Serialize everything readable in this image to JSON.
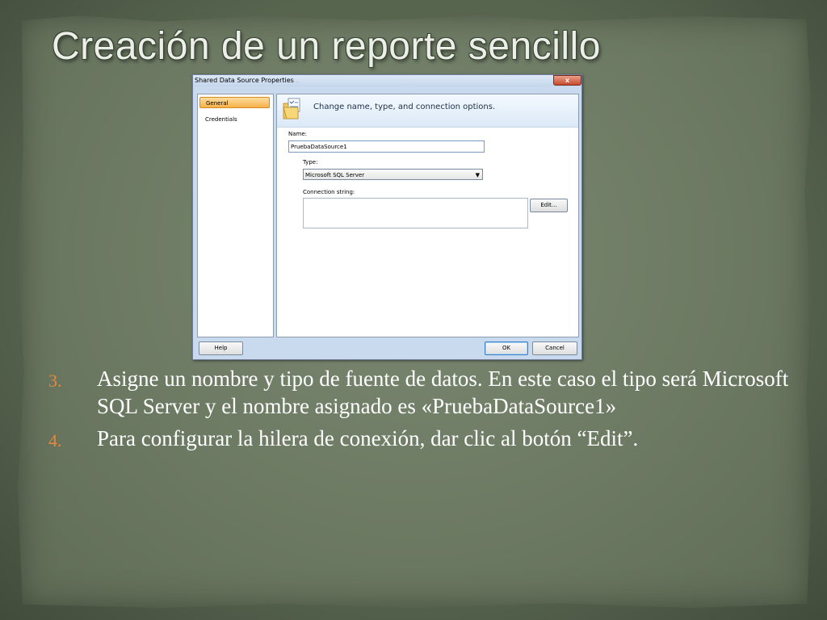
{
  "slide": {
    "title": "Creación de un reporte sencillo"
  },
  "dialog": {
    "title": "Shared Data Source Properties",
    "title_background_text": "...",
    "close_label": "x",
    "nav": [
      {
        "label": "General",
        "selected": true
      },
      {
        "label": "Credentials",
        "selected": false
      }
    ],
    "header_text": "Change name, type, and connection options.",
    "name_label": "Name:",
    "name_value": "PruebaDataSource1",
    "type_label": "Type:",
    "type_value": "Microsoft SQL Server",
    "connection_label": "Connection string:",
    "connection_value": "",
    "edit_label": "Edit...",
    "help_label": "Help",
    "ok_label": "OK",
    "cancel_label": "Cancel"
  },
  "bullets": [
    {
      "number": "3.",
      "text": "Asigne un nombre y tipo de fuente de datos. En este caso el tipo será Microsoft SQL Server y el nombre asignado es «PruebaDataSource1»"
    },
    {
      "number": "4.",
      "text": "Para configurar la hilera de conexión, dar clic al botón “Edit”."
    }
  ],
  "colors": {
    "background": "#57654f",
    "paper": "#6d7a63",
    "bullet_number": "#e8873a",
    "nav_selected": "#f7b24a"
  }
}
